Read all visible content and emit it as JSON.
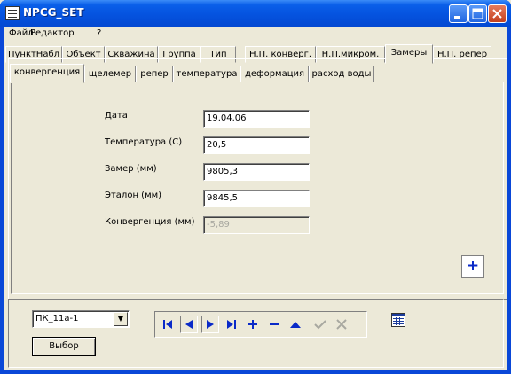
{
  "window": {
    "title": "NPCG_SET"
  },
  "menu": [
    "Файл",
    "Редактор",
    "?"
  ],
  "main_tabs": [
    "ПунктНабл",
    "Объект",
    "Скважина",
    "Группа",
    "Тип",
    "Н.П. конверг.",
    "Н.П.микром.",
    "Замеры",
    "Н.П. репер"
  ],
  "sub_tabs": [
    "конвергенция",
    "щелемер",
    "репер",
    "температура",
    "деформация",
    "расход воды"
  ],
  "form": {
    "date": {
      "label": "Дата",
      "value": "19.04.06"
    },
    "temperature": {
      "label": "Температура  (С)",
      "value": "20,5"
    },
    "measurement": {
      "label": "Замер  (мм)",
      "value": "9805,3"
    },
    "reference": {
      "label": "Эталон (мм)",
      "value": "9845,5"
    },
    "convergence": {
      "label": "Конвергенция (мм)",
      "value": "-5,89"
    }
  },
  "add_button": "+",
  "selector": {
    "value": "ПК_11а-1",
    "button": "Выбор"
  },
  "navigator": [
    "first",
    "prior",
    "next",
    "last",
    "insert",
    "delete",
    "edit",
    "post",
    "cancel"
  ],
  "colors": {
    "title_bar": "#0553DF",
    "face": "#ECE9D8",
    "nav_icon": "#0A2AC8"
  }
}
